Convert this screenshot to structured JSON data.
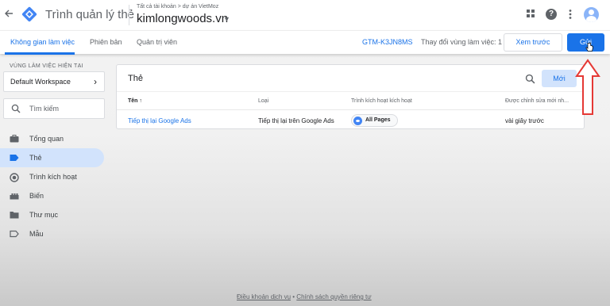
{
  "header": {
    "app_title": "Trình quản lý thẻ",
    "breadcrumb": "Tất cả tài khoản > dự án VietMoz",
    "container_name": "kimlongwoods.vn"
  },
  "subnav": {
    "tabs": [
      {
        "label": "Không gian làm việc"
      },
      {
        "label": "Phiên bản"
      },
      {
        "label": "Quản trị viên"
      }
    ],
    "container_id": "GTM-K3JN8MS",
    "workspace_changes": "Thay đổi vùng làm việc: 1",
    "preview_label": "Xem trước",
    "submit_label": "Gửi"
  },
  "sidebar": {
    "workspace_label": "VÙNG LÀM VIỆC HIỆN TẠI",
    "workspace_name": "Default Workspace",
    "search_placeholder": "Tìm kiếm",
    "items": [
      {
        "label": "Tổng quan",
        "icon": "briefcase-icon"
      },
      {
        "label": "Thẻ",
        "icon": "tag-icon"
      },
      {
        "label": "Trình kích hoạt",
        "icon": "trigger-icon"
      },
      {
        "label": "Biến",
        "icon": "variables-icon"
      },
      {
        "label": "Thư mục",
        "icon": "folder-icon"
      },
      {
        "label": "Mẫu",
        "icon": "template-icon"
      }
    ],
    "active_item": "Thẻ"
  },
  "tags_card": {
    "title": "Thẻ",
    "new_label": "Mới",
    "columns": [
      "Tên ↑",
      "Loại",
      "Trình kích hoạt kích hoạt",
      "Được chỉnh sửa mới nh..."
    ],
    "rows": [
      {
        "name": "Tiếp thị lại Google Ads",
        "type": "Tiếp thị lại trên Google Ads",
        "trigger": "All Pages",
        "edited": "vài giây trước"
      }
    ]
  },
  "footer": {
    "terms": "Điều khoản dịch vụ",
    "separator": " • ",
    "privacy": "Chính sách quyền riêng tư"
  },
  "colors": {
    "accent": "#1a73e8",
    "active_nav_bg": "#d2e3fc",
    "annotation_arrow": "#e53935"
  }
}
